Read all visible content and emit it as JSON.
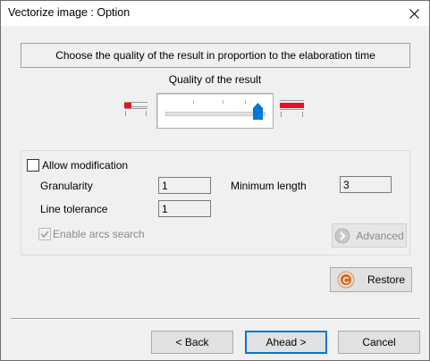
{
  "window": {
    "title": "Vectorize image : Option"
  },
  "header": {
    "description": "Choose the quality of the result in proportion to the elaboration time"
  },
  "quality": {
    "label": "Quality of the result",
    "level_fraction": 1.0,
    "low_icon": "low-quality-icon",
    "high_icon": "high-quality-icon"
  },
  "options": {
    "allow_modification_label": "Allow modification",
    "allow_modification_checked": false,
    "granularity_label": "Granularity",
    "granularity_value": "1",
    "min_length_label": "Minimum length",
    "min_length_value": "3",
    "line_tolerance_label": "Line tolerance",
    "line_tolerance_value": "1",
    "arcs_label": "Enable arcs search",
    "arcs_checked": true,
    "advanced_label": "Advanced"
  },
  "buttons": {
    "restore": "Restore",
    "back": "< Back",
    "ahead": "Ahead >",
    "cancel": "Cancel"
  },
  "colors": {
    "thumb": "#0078d7",
    "quality_bar": "#e81123",
    "primary_border": "#0078d7"
  }
}
